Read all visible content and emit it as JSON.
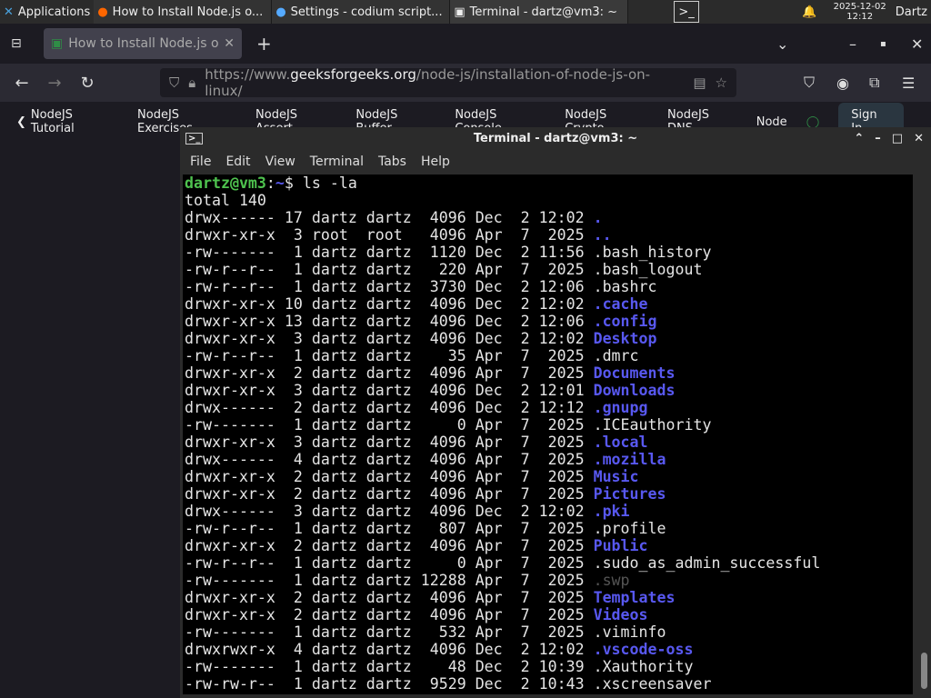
{
  "taskbar": {
    "apps_label": "Applications",
    "tasks": [
      "How to Install Node.js o...",
      "Settings - codium script...",
      "Terminal - dartz@vm3: ~"
    ],
    "date": "2025-12-02",
    "time": "12:12",
    "user": "Dartz"
  },
  "browser": {
    "tab_title": "How to Install Node.js on",
    "url_prefix": "https://www.",
    "url_domain": "geeksforgeeks.org",
    "url_path": "/node-js/installation-of-node-js-on-linux/",
    "bookmarks": [
      "NodeJS Tutorial",
      "NodeJS Exercises",
      "NodeJS Assert",
      "NodeJS Buffer",
      "NodeJS Console",
      "NodeJS Crypto",
      "NodeJS DNS",
      "Node"
    ],
    "sign_in": "Sign In"
  },
  "terminal": {
    "title": "Terminal - dartz@vm3: ~",
    "menu": [
      "File",
      "Edit",
      "View",
      "Terminal",
      "Tabs",
      "Help"
    ],
    "prompt_user": "dartz@vm3",
    "prompt_path": "~",
    "prompt_sym": "$ ",
    "command": "ls -la",
    "total": "total 140",
    "rows": [
      {
        "meta": "drwx------ 17 dartz dartz  4096 Dec  2 12:02 ",
        "name": ".",
        "kind": "dir"
      },
      {
        "meta": "drwxr-xr-x  3 root  root   4096 Apr  7  2025 ",
        "name": "..",
        "kind": "dir"
      },
      {
        "meta": "-rw-------  1 dartz dartz  1120 Dec  2 11:56 ",
        "name": ".bash_history",
        "kind": "file"
      },
      {
        "meta": "-rw-r--r--  1 dartz dartz   220 Apr  7  2025 ",
        "name": ".bash_logout",
        "kind": "file"
      },
      {
        "meta": "-rw-r--r--  1 dartz dartz  3730 Dec  2 12:06 ",
        "name": ".bashrc",
        "kind": "file"
      },
      {
        "meta": "drwxr-xr-x 10 dartz dartz  4096 Dec  2 12:02 ",
        "name": ".cache",
        "kind": "dir"
      },
      {
        "meta": "drwxr-xr-x 13 dartz dartz  4096 Dec  2 12:06 ",
        "name": ".config",
        "kind": "dir"
      },
      {
        "meta": "drwxr-xr-x  3 dartz dartz  4096 Dec  2 12:02 ",
        "name": "Desktop",
        "kind": "dir"
      },
      {
        "meta": "-rw-r--r--  1 dartz dartz    35 Apr  7  2025 ",
        "name": ".dmrc",
        "kind": "file"
      },
      {
        "meta": "drwxr-xr-x  2 dartz dartz  4096 Apr  7  2025 ",
        "name": "Documents",
        "kind": "dir"
      },
      {
        "meta": "drwxr-xr-x  3 dartz dartz  4096 Dec  2 12:01 ",
        "name": "Downloads",
        "kind": "dir"
      },
      {
        "meta": "drwx------  2 dartz dartz  4096 Dec  2 12:12 ",
        "name": ".gnupg",
        "kind": "dir"
      },
      {
        "meta": "-rw-------  1 dartz dartz     0 Apr  7  2025 ",
        "name": ".ICEauthority",
        "kind": "file"
      },
      {
        "meta": "drwxr-xr-x  3 dartz dartz  4096 Apr  7  2025 ",
        "name": ".local",
        "kind": "dir"
      },
      {
        "meta": "drwx------  4 dartz dartz  4096 Apr  7  2025 ",
        "name": ".mozilla",
        "kind": "dir"
      },
      {
        "meta": "drwxr-xr-x  2 dartz dartz  4096 Apr  7  2025 ",
        "name": "Music",
        "kind": "dir"
      },
      {
        "meta": "drwxr-xr-x  2 dartz dartz  4096 Apr  7  2025 ",
        "name": "Pictures",
        "kind": "dir"
      },
      {
        "meta": "drwx------  3 dartz dartz  4096 Dec  2 12:02 ",
        "name": ".pki",
        "kind": "dir"
      },
      {
        "meta": "-rw-r--r--  1 dartz dartz   807 Apr  7  2025 ",
        "name": ".profile",
        "kind": "file"
      },
      {
        "meta": "drwxr-xr-x  2 dartz dartz  4096 Apr  7  2025 ",
        "name": "Public",
        "kind": "dir"
      },
      {
        "meta": "-rw-r--r--  1 dartz dartz     0 Apr  7  2025 ",
        "name": ".sudo_as_admin_successful",
        "kind": "file"
      },
      {
        "meta": "-rw-------  1 dartz dartz 12288 Apr  7  2025 ",
        "name": ".swp",
        "kind": "dim"
      },
      {
        "meta": "drwxr-xr-x  2 dartz dartz  4096 Apr  7  2025 ",
        "name": "Templates",
        "kind": "dir"
      },
      {
        "meta": "drwxr-xr-x  2 dartz dartz  4096 Apr  7  2025 ",
        "name": "Videos",
        "kind": "dir"
      },
      {
        "meta": "-rw-------  1 dartz dartz   532 Apr  7  2025 ",
        "name": ".viminfo",
        "kind": "file"
      },
      {
        "meta": "drwxrwxr-x  4 dartz dartz  4096 Dec  2 12:02 ",
        "name": ".vscode-oss",
        "kind": "dir"
      },
      {
        "meta": "-rw-------  1 dartz dartz    48 Dec  2 10:39 ",
        "name": ".Xauthority",
        "kind": "file"
      },
      {
        "meta": "-rw-rw-r--  1 dartz dartz  9529 Dec  2 10:43 ",
        "name": ".xscreensaver",
        "kind": "file"
      }
    ]
  },
  "colors": {
    "dir": "#5858f0",
    "prompt": "#4ec24e",
    "terminal_bg": "#000000"
  }
}
